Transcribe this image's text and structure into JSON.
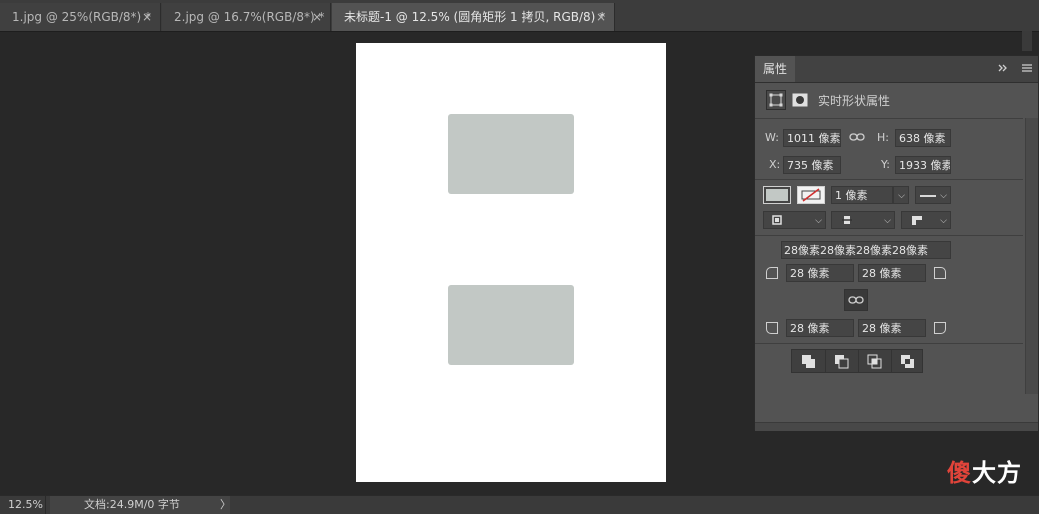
{
  "tabs": [
    {
      "label": "1.jpg @ 25%(RGB/8*) *",
      "close": "×",
      "active": false
    },
    {
      "label": "2.jpg @ 16.7%(RGB/8*) *",
      "close": "×",
      "active": false
    },
    {
      "label": "未标题-1 @ 12.5% (圆角矩形 1 拷贝, RGB/8) *",
      "close": "×",
      "active": true
    }
  ],
  "panel": {
    "tab_label": "属性",
    "expand_icon": "double-chevron-right-icon",
    "menu_icon": "panel-menu-icon",
    "section_title": "实时形状属性",
    "w_label": "W:",
    "w_value": "1011 像素",
    "h_label": "H:",
    "h_value": "638 像素",
    "x_label": "X:",
    "x_value": "735 像素",
    "y_label": "Y:",
    "y_value": "1933 像素",
    "fill_color": "#c2c8c5",
    "stroke_width": "1 像素",
    "corner_all": "28像素28像素28像素28像素",
    "corner_tl": "28 像素",
    "corner_tr": "28 像素",
    "corner_bl": "28 像素",
    "corner_br": "28 像素"
  },
  "status": {
    "zoom": "12.5%",
    "doc": "文档:24.9M/0 字节",
    "arrow": "〉"
  },
  "watermark": {
    "first": "傻",
    "rest": "大方"
  }
}
